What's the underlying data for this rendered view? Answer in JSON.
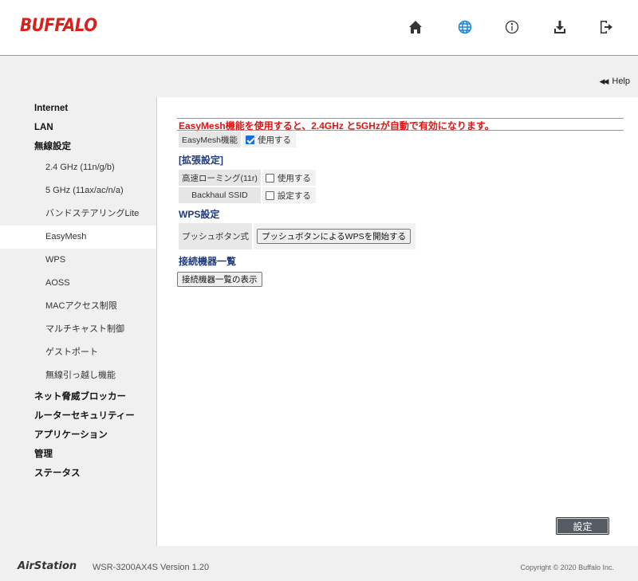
{
  "header": {
    "brand": "BUFFALO",
    "icons": [
      "home-icon",
      "globe-icon",
      "info-icon",
      "download-icon",
      "logout-icon"
    ],
    "active_icon_color": "#1a8cd8"
  },
  "help_label": "Help",
  "sidebar": {
    "items": [
      {
        "label": "Internet",
        "level": "top"
      },
      {
        "label": "LAN",
        "level": "top"
      },
      {
        "label": "無線設定",
        "level": "top"
      },
      {
        "label": "2.4 GHz (11n/g/b)",
        "level": "sub"
      },
      {
        "label": "5 GHz (11ax/ac/n/a)",
        "level": "sub"
      },
      {
        "label": "バンドステアリングLite",
        "level": "sub"
      },
      {
        "label": "EasyMesh",
        "level": "sub",
        "active": true
      },
      {
        "label": "WPS",
        "level": "sub"
      },
      {
        "label": "AOSS",
        "level": "sub"
      },
      {
        "label": "MACアクセス制限",
        "level": "sub"
      },
      {
        "label": "マルチキャスト制御",
        "level": "sub"
      },
      {
        "label": "ゲストポート",
        "level": "sub"
      },
      {
        "label": "無線引っ越し機能",
        "level": "sub"
      },
      {
        "label": "ネット脅威ブロッカー",
        "level": "top"
      },
      {
        "label": "ルーターセキュリティー",
        "level": "top"
      },
      {
        "label": "アプリケーション",
        "level": "top"
      },
      {
        "label": "管理",
        "level": "top"
      },
      {
        "label": "ステータス",
        "level": "top"
      }
    ]
  },
  "main": {
    "notice": "EasyMesh機能を使用すると、2.4GHz と5GHzが自動で有効になります。",
    "easymesh": {
      "label": "EasyMesh機能",
      "option": "使用する",
      "checked": true
    },
    "advanced": {
      "heading": "[拡張設定]",
      "fast_roaming": {
        "label": "高速ローミング(11r)",
        "option": "使用する",
        "checked": false
      },
      "backhaul": {
        "label": "Backhaul SSID",
        "option": "設定する",
        "checked": false
      }
    },
    "wps": {
      "heading": "WPS設定",
      "label": "プッシュボタン式",
      "button": "プッシュボタンによるWPSを開始する"
    },
    "devices": {
      "heading": "接続機器一覧",
      "button": "接続機器一覧の表示"
    },
    "apply_button": "設定"
  },
  "footer": {
    "product": "AirStation",
    "model": "WSR-3200AX4S  Version 1.20",
    "copyright": "Copyright © 2020 Buffalo Inc."
  },
  "colors": {
    "brand_red": "#d9211c",
    "notice_red": "#e01414",
    "heading_blue": "#1f3a7a",
    "checkbox_blue": "#1a6fd6"
  }
}
